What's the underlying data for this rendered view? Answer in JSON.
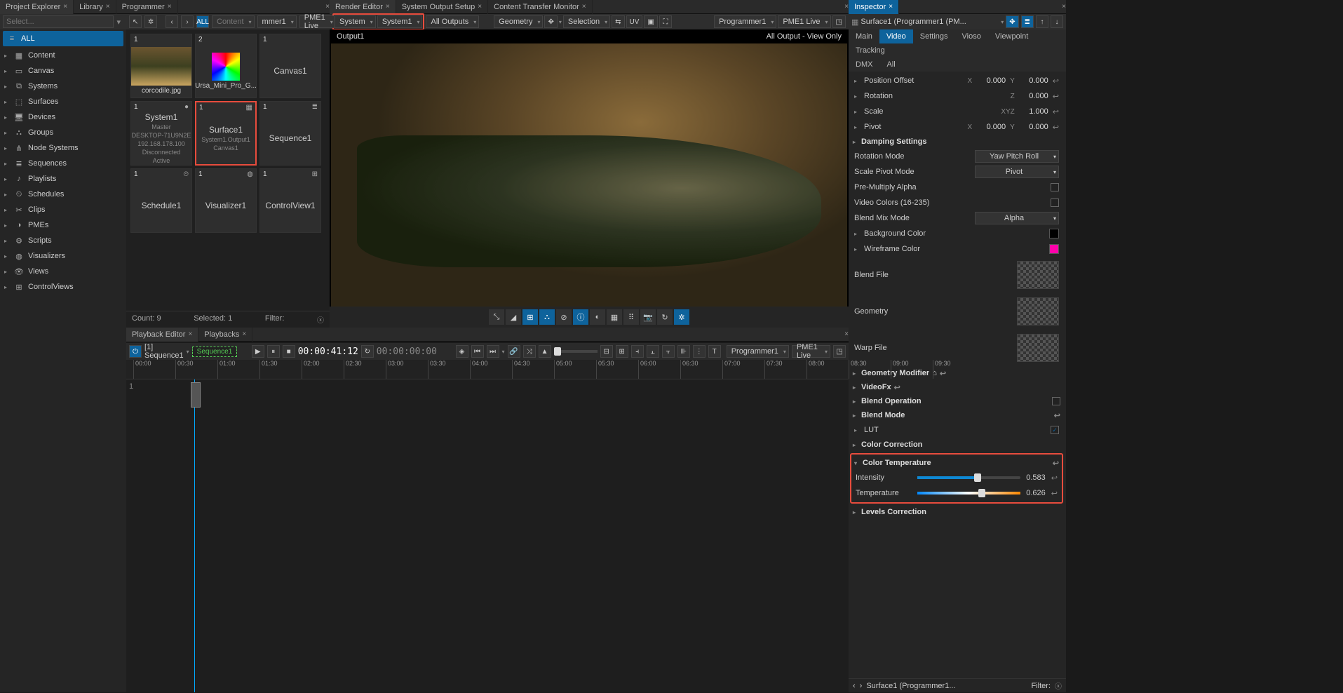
{
  "tabs_left": [
    {
      "t": "Project Explorer"
    },
    {
      "t": "Library"
    },
    {
      "t": "Programmer"
    }
  ],
  "tabs_center": [
    {
      "t": "Render Editor",
      "a": 1
    },
    {
      "t": "System Output Setup"
    },
    {
      "t": "Content Transfer Monitor"
    }
  ],
  "tabs_right": [
    {
      "t": "Inspector",
      "a": 1
    }
  ],
  "tabs_bottom": [
    {
      "t": "Playback Editor"
    },
    {
      "t": "Playbacks"
    }
  ],
  "sidebar": {
    "select_ph": "Select...",
    "all": "ALL",
    "items": [
      {
        "t": "Content",
        "i": "▦"
      },
      {
        "t": "Canvas",
        "i": "▭"
      },
      {
        "t": "Systems",
        "i": "⧉"
      },
      {
        "t": "Surfaces",
        "i": "⬚"
      },
      {
        "t": "Devices",
        "i": "🖥"
      },
      {
        "t": "Groups",
        "i": "⛬"
      },
      {
        "t": "Node Systems",
        "i": "⋔"
      },
      {
        "t": "Sequences",
        "i": "≣"
      },
      {
        "t": "Playlists",
        "i": "♪"
      },
      {
        "t": "Schedules",
        "i": "⏲"
      },
      {
        "t": "Clips",
        "i": "✂"
      },
      {
        "t": "PMEs",
        "i": "◑"
      },
      {
        "t": "Scripts",
        "i": "⚙"
      },
      {
        "t": "Visualizers",
        "i": "◍"
      },
      {
        "t": "Views",
        "i": "👁"
      },
      {
        "t": "ControlViews",
        "i": "⊞"
      }
    ]
  },
  "lib_tb": {
    "all": "ALL",
    "content": "Content",
    "mmer": "mmer1",
    "pme": "PME1 Live"
  },
  "library": {
    "items": [
      {
        "n": "1",
        "title": "corcodile.jpg",
        "thumb": "croc"
      },
      {
        "n": "2",
        "title": "Ursa_Mini_Pro_G...",
        "thumb": "cube"
      },
      {
        "n": "1",
        "title": "Canvas1"
      },
      {
        "n": "1",
        "title": "System1",
        "sub": "Master",
        "sub2": "DESKTOP-71U9N2E",
        "sub3": "192.168.178.100",
        "sub4": "Disconnected",
        "sub5": "Active",
        "ico": "●"
      },
      {
        "n": "1",
        "title": "Surface1",
        "sub": "System1.Output1",
        "sub2": "Canvas1",
        "ico": "▦",
        "sel": 1
      },
      {
        "n": "1",
        "title": "Sequence1",
        "ico": "≣"
      },
      {
        "n": "1",
        "title": "Schedule1",
        "ico": "⏲"
      },
      {
        "n": "1",
        "title": "Visualizer1",
        "ico": "◍"
      },
      {
        "n": "1",
        "title": "ControlView1",
        "ico": "⊞"
      }
    ],
    "count_l": "Count:",
    "count_v": "9",
    "sel_l": "Selected:",
    "sel_v": "1",
    "filter_l": "Filter:"
  },
  "render_tb": {
    "system": "System",
    "system1": "System1",
    "all_out": "All Outputs",
    "geom": "Geometry",
    "selection": "Selection",
    "uv": "UV",
    "prog": "Programmer1",
    "pme": "PME1 Live"
  },
  "viewport": {
    "left": "Output1",
    "right": "All Output - View Only"
  },
  "insp_hdr": {
    "obj": "Surface1 (Programmer1 (PM..."
  },
  "insp_tabs1": [
    "Main",
    "Video",
    "Settings",
    "Vioso",
    "Viewpoint",
    "Tracking"
  ],
  "insp_tabs2": [
    "DMX",
    "All"
  ],
  "insp": {
    "pos_off": "Position Offset",
    "x": "X",
    "y": "Y",
    "z": "Z",
    "xyz": "XYZ",
    "v0": "0.000",
    "v1": "1.000",
    "rotation": "Rotation",
    "scale": "Scale",
    "pivot": "Pivot",
    "damping": "Damping Settings",
    "rot_mode": "Rotation Mode",
    "rot_mode_v": "Yaw Pitch Roll",
    "scale_pivot": "Scale Pivot Mode",
    "scale_pivot_v": "Pivot",
    "premult": "Pre-Multiply Alpha",
    "vidcol": "Video Colors (16-235)",
    "blendmix": "Blend Mix Mode",
    "blendmix_v": "Alpha",
    "bgcolor": "Background Color",
    "bgcolor_v": "#000000",
    "wfcolor": "Wireframe Color",
    "wfcolor_v": "#ff00aa",
    "blendfile": "Blend File",
    "geometry": "Geometry",
    "warpfile": "Warp File",
    "geomod": "Geometry Modifier",
    "videofx": "VideoFx",
    "blendop": "Blend Operation",
    "blendmode": "Blend Mode",
    "lut": "LUT",
    "colorcorr": "Color Correction",
    "colortemp": "Color Temperature",
    "intensity": "Intensity",
    "intensity_v": "0.583",
    "temperature": "Temperature",
    "temperature_v": "0.626",
    "levels": "Levels Correction",
    "footer": "Surface1 (Programmer1...",
    "filter": "Filter:"
  },
  "timeline": {
    "seq": "[1] Sequence1",
    "seq2": "Sequence1",
    "t1": "00:00:41:12",
    "t2": "00:00:00:00",
    "prog": "Programmer1",
    "pme": "PME1 Live",
    "ticks": [
      "00:00",
      "00:30",
      "01:00",
      "01:30",
      "02:00",
      "02:30",
      "03:00",
      "03:30",
      "04:00",
      "04:30",
      "05:00",
      "05:30",
      "06:00",
      "06:30",
      "07:00",
      "07:30",
      "08:00",
      "08:30",
      "09:00",
      "09:30"
    ]
  }
}
